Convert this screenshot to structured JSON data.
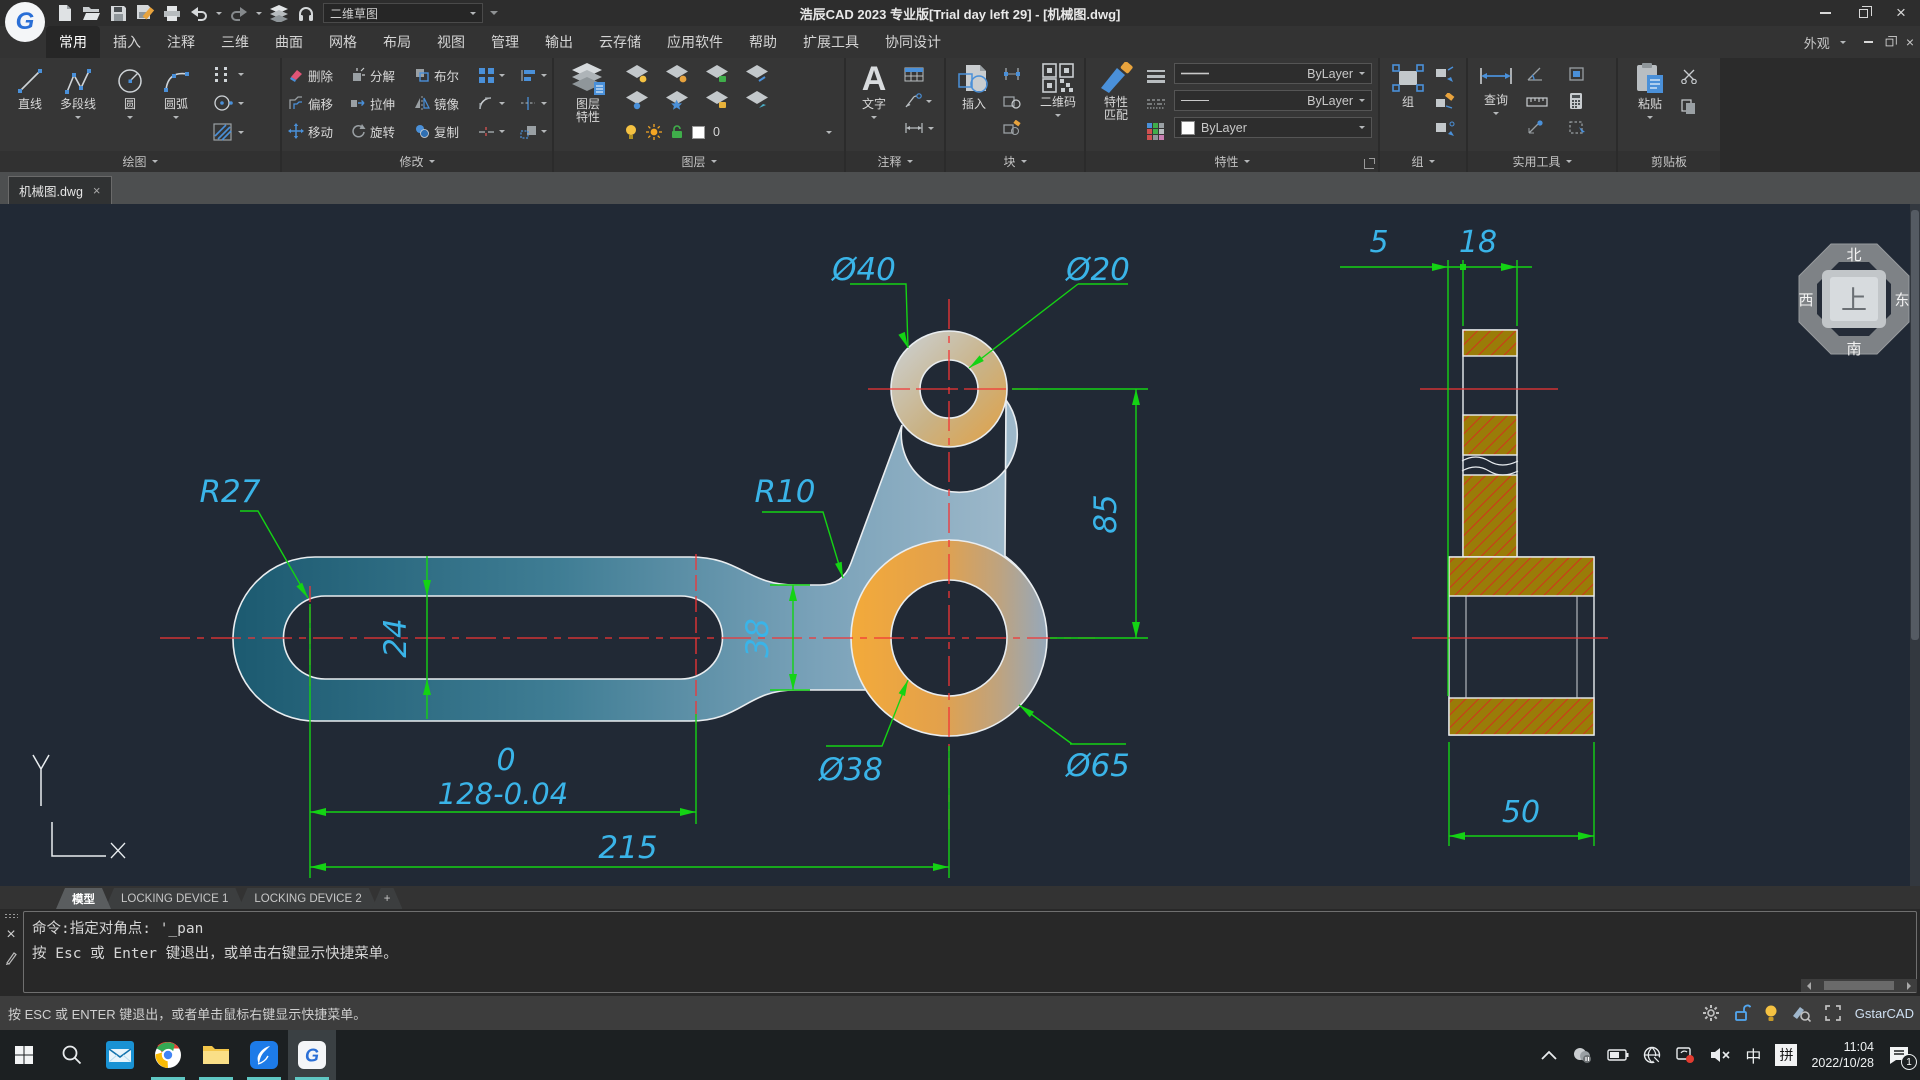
{
  "colors": {
    "canvas_bg": "#212935",
    "dim_text": "#3ab4e8",
    "dim_line": "#14d314",
    "centerline": "#f23535",
    "accent_blue": "#4a90d9",
    "accent_orange": "#e8a33d",
    "running_underline": "#5fc7c3"
  },
  "titlebar": {
    "title": "浩辰CAD 2023 专业版[Trial day left 29] - [机械图.dwg]",
    "workspace": "二维草图"
  },
  "icons": {
    "close": "×"
  },
  "ribbon": {
    "tabs": [
      "常用",
      "插入",
      "注释",
      "三维",
      "曲面",
      "网格",
      "布局",
      "视图",
      "管理",
      "输出",
      "云存储",
      "应用软件",
      "帮助",
      "扩展工具",
      "协同设计"
    ],
    "appearance": "外观",
    "draw": {
      "label": "绘图",
      "tools": [
        "直线",
        "多段线",
        "圆",
        "圆弧"
      ]
    },
    "modify": {
      "label": "修改",
      "tools": [
        "删除",
        "分解",
        "布尔",
        "偏移",
        "拉伸",
        "镜像",
        "移动",
        "旋转",
        "复制"
      ]
    },
    "layer": {
      "label": "图层",
      "big_line1": "图层",
      "big_line2": "特性",
      "current_layer": "0"
    },
    "annotate": {
      "label": "注释",
      "big": "文字"
    },
    "block": {
      "label": "块",
      "big": "插入",
      "qr": "二维码"
    },
    "properties": {
      "label": "特性",
      "big_line1": "特性",
      "big_line2": "匹配",
      "bylayer": "ByLayer"
    },
    "group": {
      "label": "组",
      "big": "组"
    },
    "utilities": {
      "label": "实用工具",
      "big": "查询"
    },
    "clipboard": {
      "label": "剪贴板",
      "big": "粘贴"
    }
  },
  "file_tab": {
    "name": "机械图.dwg"
  },
  "drawing": {
    "dims": {
      "d40": "Ø40",
      "d20": "Ø20",
      "r27": "R27",
      "r10": "R10",
      "w24": "24",
      "w38": "38",
      "h85": "85",
      "tol_line1": "0",
      "tol_line2": "128-0.04",
      "len215": "215",
      "d38": "Ø38",
      "d65": "Ø65",
      "s5": "5",
      "s18": "18",
      "s50": "50"
    },
    "compass": {
      "north": "北",
      "south": "南",
      "west": "西",
      "east": "东",
      "top": "上"
    }
  },
  "layout_tabs": {
    "model": "模型",
    "tab1": "LOCKING DEVICE 1",
    "tab2": "LOCKING DEVICE 2",
    "add": "+"
  },
  "command": {
    "line1": "命令:指定对角点: '_pan",
    "line2": "按 Esc 或 Enter 键退出，或单击右键显示快捷菜单。"
  },
  "status_bar": {
    "hint": "按 ESC 或 ENTER 键退出，或者单击鼠标右键显示快捷菜单。",
    "brand": "GstarCAD"
  },
  "taskbar": {
    "ime_primary": "中",
    "ime_secondary": "拼",
    "time": "11:04",
    "date": "2022/10/28",
    "notification_count": "1"
  }
}
